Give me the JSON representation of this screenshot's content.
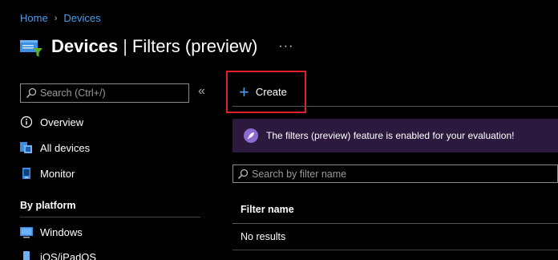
{
  "breadcrumb": {
    "home": "Home",
    "separator": "›",
    "devices": "Devices"
  },
  "title": {
    "main": "Devices",
    "separator": "|",
    "sub": "Filters (preview)",
    "more": "···"
  },
  "sidebar": {
    "search_placeholder": "Search (Ctrl+/)",
    "collapse": "«",
    "items": [
      {
        "label": "Overview",
        "icon": "info-icon"
      },
      {
        "label": "All devices",
        "icon": "devices-icon"
      },
      {
        "label": "Monitor",
        "icon": "monitor-icon"
      }
    ],
    "section": "By platform",
    "platform_items": [
      {
        "label": "Windows",
        "icon": "windows-icon"
      },
      {
        "label": "iOS/iPadOS",
        "icon": "ios-icon"
      }
    ]
  },
  "toolbar": {
    "create_label": "Create",
    "create_icon": "plus-icon"
  },
  "banner": {
    "text": "The filters (preview) feature is enabled for your evaluation!",
    "icon": "rocket-icon"
  },
  "filter_search": {
    "placeholder": "Search by filter name"
  },
  "table": {
    "columns": [
      "Filter name"
    ],
    "empty_text": "No results"
  },
  "colors": {
    "accent": "#4f9ce8",
    "highlight": "#e0202b",
    "banner_bg": "#2c1a3e"
  }
}
